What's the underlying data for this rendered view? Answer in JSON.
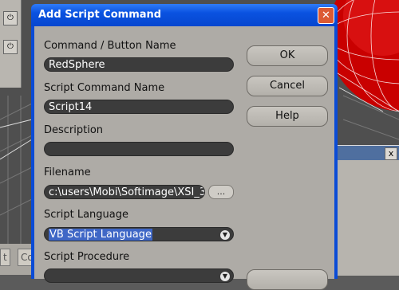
{
  "dialog": {
    "title": "Add Script Command",
    "close_label": "✕",
    "fields": {
      "command_name": {
        "label": "Command / Button Name",
        "value": "RedSphere"
      },
      "script_command_name": {
        "label": "Script Command Name",
        "value": "Script14"
      },
      "description": {
        "label": "Description",
        "value": ""
      },
      "filename": {
        "label": "Filename",
        "value": "c:\\users\\Mobi\\Softimage\\XSI_3",
        "browse_label": "..."
      },
      "script_language": {
        "label": "Script Language",
        "value": "VB Script Language"
      },
      "script_procedure": {
        "label": "Script Procedure",
        "value": ""
      }
    },
    "buttons": {
      "ok": "OK",
      "cancel": "Cancel",
      "help": "Help"
    }
  },
  "background": {
    "bottom_tabs": [
      "t",
      "Co"
    ],
    "right_panel_close": "x"
  },
  "colors": {
    "title_bar": "#0a52e0",
    "dialog_body": "#aeaba6",
    "field_bg": "#3c3c3c",
    "selection": "#3f67c6",
    "sphere": "#d10000"
  }
}
